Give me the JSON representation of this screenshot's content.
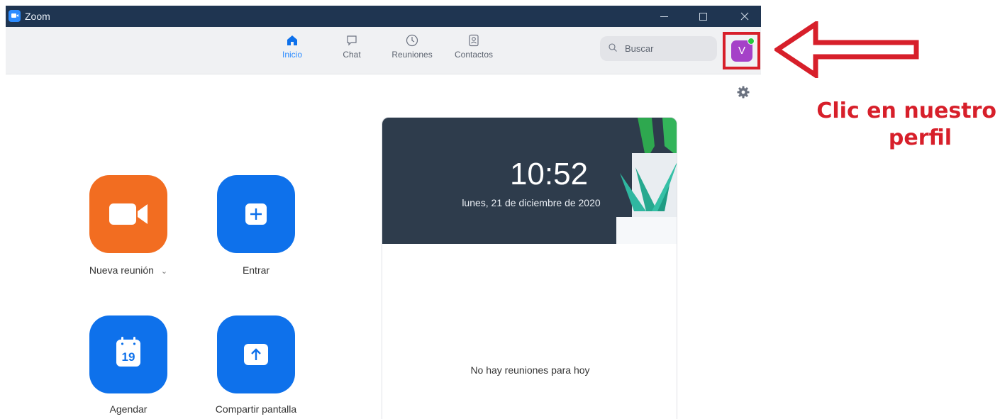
{
  "window": {
    "title": "Zoom"
  },
  "nav": {
    "items": [
      {
        "label": "Inicio",
        "icon": "home-icon",
        "active": true
      },
      {
        "label": "Chat",
        "icon": "chat-icon",
        "active": false
      },
      {
        "label": "Reuniones",
        "icon": "clock-icon",
        "active": false
      },
      {
        "label": "Contactos",
        "icon": "contacts-icon",
        "active": false
      }
    ],
    "search_placeholder": "Buscar",
    "avatar_initial": "V"
  },
  "actions": {
    "new_meeting": "Nueva reunión",
    "new_meeting_chevron": "⌄",
    "join": "Entrar",
    "schedule": "Agendar",
    "schedule_day": "19",
    "share": "Compartir pantalla"
  },
  "panel": {
    "time": "10:52",
    "date": "lunes, 21 de diciembre de 2020",
    "empty_message": "No hay reuniones para hoy"
  },
  "annotation": {
    "line1": "Clic en nuestro",
    "line2": "perfil",
    "color": "#d71f2a"
  },
  "colors": {
    "accent_blue": "#0e71eb",
    "orange": "#f26d21",
    "titlebar": "#1f3551",
    "avatar": "#a541c8",
    "online": "#27c73d"
  }
}
